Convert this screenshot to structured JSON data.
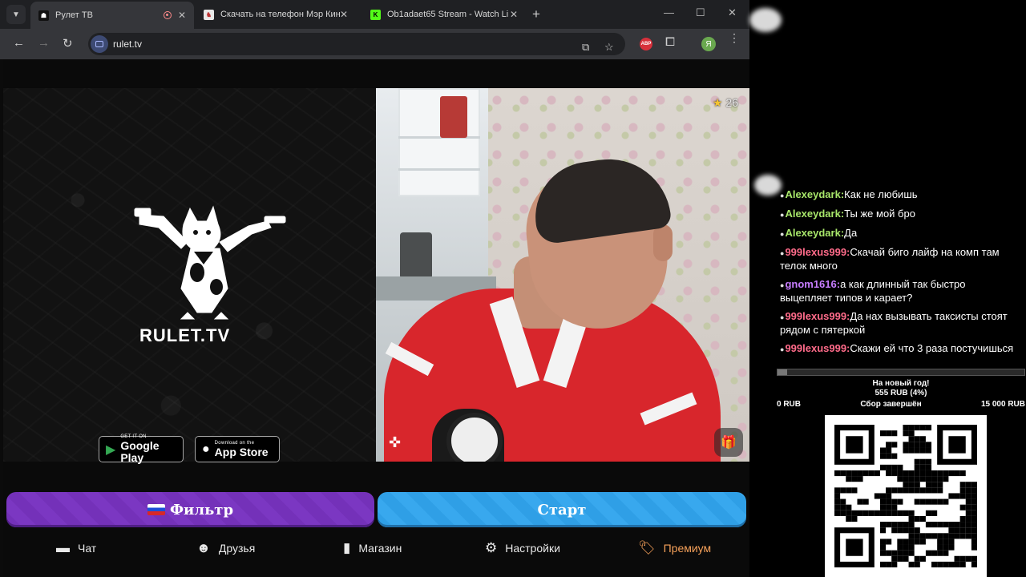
{
  "browser": {
    "tabs": [
      {
        "title": "Рулет ТВ",
        "active": true
      },
      {
        "title": "Скачать на телефон Мэр Кинг"
      },
      {
        "title": "Ob1adaet65 Stream - Watch Li"
      }
    ],
    "url": "rulet.tv",
    "profile_initial": "Я",
    "abp_label": "ABP"
  },
  "page": {
    "logo_text": "RULET.TV",
    "google_play": {
      "small": "GET IT ON",
      "big": "Google Play"
    },
    "app_store": {
      "small": "Download on the",
      "big": "App Store"
    },
    "rating": "26",
    "filter_label": "Фильтр",
    "start_label": "Старт",
    "nav": [
      {
        "label": "Чат",
        "icon": "chat-icon"
      },
      {
        "label": "Друзья",
        "icon": "friends-icon"
      },
      {
        "label": "Магазин",
        "icon": "shop-bag-icon"
      },
      {
        "label": "Настройки",
        "icon": "gear-icon"
      },
      {
        "label": "Премиум",
        "icon": "premium-tag-icon"
      }
    ],
    "premium_color": "#f6a15a"
  },
  "overlay": {
    "chat": [
      {
        "nick": "Alexeydark:",
        "text": "Как не любишь",
        "color": "#a8e66a"
      },
      {
        "nick": "Alexeydark:",
        "text": "Ты же мой бро",
        "color": "#a8e66a"
      },
      {
        "nick": "Alexeydark:",
        "text": "Да",
        "color": "#a8e66a"
      },
      {
        "nick": "999lexus999:",
        "text": "Скачай биго лайф на комп там телок много",
        "color": "#ff6b8a"
      },
      {
        "nick": "gnom1616:",
        "text": "а как длинный так быстро выцепляет типов и карает?",
        "color": "#c77dff"
      },
      {
        "nick": "999lexus999:",
        "text": "Да нах вызывать таксисты стоят рядом с пятеркой",
        "color": "#ff6b8a"
      },
      {
        "nick": "999lexus999:",
        "text": "Скажи ей что 3 раза постучишься",
        "color": "#ff6b8a"
      }
    ],
    "goal": {
      "title": "На новый год!",
      "amount": "555 RUB (4%)",
      "progress": 0.04,
      "min": "0 RUB",
      "status": "Сбор завершён",
      "max": "15 000 RUB"
    }
  }
}
